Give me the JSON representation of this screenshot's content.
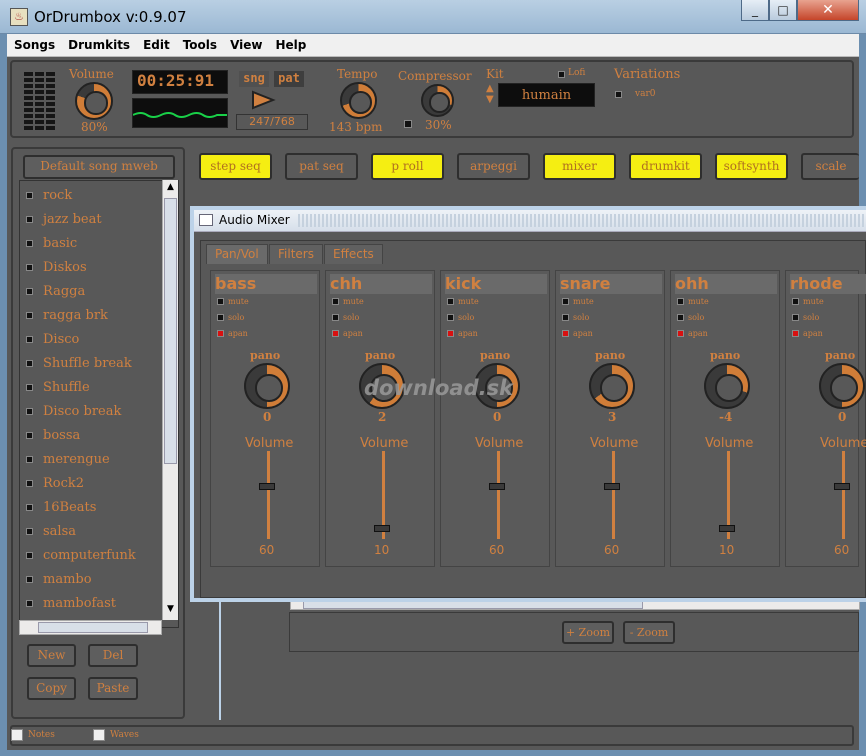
{
  "window": {
    "title": "OrDrumbox v:0.9.07"
  },
  "menu": [
    "Songs",
    "Drumkits",
    "Edit",
    "Tools",
    "View",
    "Help"
  ],
  "transport": {
    "volume_label": "Volume",
    "volume_value": "80%",
    "volume_level": 0.8,
    "time": "00:25:91",
    "mode_song": "sng",
    "mode_pattern": "pat",
    "position": "247/768",
    "tempo_label": "Tempo",
    "tempo_value": "143 bpm",
    "compressor_label": "Compressor",
    "compressor_value": "30%",
    "kit_label": "Kit",
    "kit_value": "humain",
    "lofi_label": "Lofi",
    "variations_label": "Variations",
    "variation_value": "var0"
  },
  "song_panel": {
    "title": "Default song mweb",
    "songs": [
      "rock",
      "jazz beat",
      "basic",
      "Diskos",
      "Ragga",
      "ragga brk",
      "Disco",
      "Shuffle break",
      "Shuffle",
      "Disco break",
      "bossa",
      "merengue",
      "Rock2",
      "16Beats",
      "salsa",
      "computerfunk",
      "mambo",
      "mambofast"
    ],
    "buttons": {
      "new": "New",
      "del": "Del",
      "copy": "Copy",
      "paste": "Paste"
    }
  },
  "view_buttons": [
    "step seq",
    "pat seq",
    "p roll",
    "arpeggi",
    "mixer",
    "drumkit",
    "softsynth",
    "scale"
  ],
  "mixer": {
    "title": "Audio Mixer",
    "tabs": [
      "Pan/Vol",
      "Filters",
      "Effects"
    ],
    "flags": [
      "mute",
      "solo",
      "apan"
    ],
    "pano_label": "pano",
    "volume_label": "Volume",
    "channels": [
      {
        "name": "bass",
        "pano": "0",
        "volume": "60"
      },
      {
        "name": "chh",
        "pano": "2",
        "volume": "10"
      },
      {
        "name": "kick",
        "pano": "0",
        "volume": "60"
      },
      {
        "name": "snare",
        "pano": "3",
        "volume": "60"
      },
      {
        "name": "ohh",
        "pano": "-4",
        "volume": "10"
      },
      {
        "name": "rhode",
        "pano": "0",
        "volume": "60"
      }
    ]
  },
  "zoom": {
    "in": "+ Zoom",
    "out": "- Zoom"
  },
  "bottom": {
    "notes": "Notes",
    "waves": "Waves"
  },
  "watermark": "download.sk",
  "colors": {
    "accent": "#d08040",
    "panel": "#585858",
    "highlight": "#f5ee12"
  }
}
